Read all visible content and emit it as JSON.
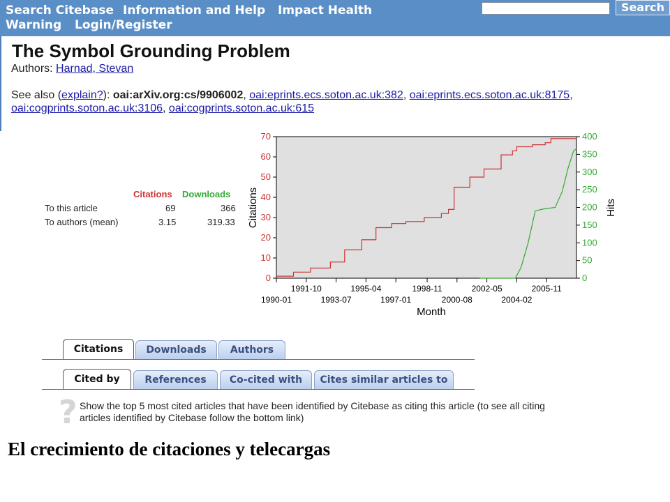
{
  "nav": {
    "links": [
      "Search Citebase",
      "Information and Help",
      "Impact Health",
      "Warning",
      "Login/Register"
    ],
    "search_placeholder": "",
    "search_button": "Search"
  },
  "article": {
    "title": "The Symbol Grounding Problem",
    "authors_label": "Authors: ",
    "author": "Harnad, Stevan",
    "see_also_label": "See also (",
    "explain_link": "explain?",
    "see_also_close": "): ",
    "primary_id": "oai:arXiv.org:cs/9906002",
    "sep": ", ",
    "other_ids": [
      "oai:eprints.ecs.soton.ac.uk:382",
      "oai:eprints.ecs.soton.ac.uk:8175",
      "oai:cogprints.soton.ac.uk:3106",
      "oai:cogprints.soton.ac.uk:615"
    ]
  },
  "stats": {
    "headers": [
      "Citations",
      "Downloads"
    ],
    "rows": [
      {
        "label": "To this article",
        "citations": "69",
        "downloads": "366"
      },
      {
        "label": "To authors (mean)",
        "citations": "3.15",
        "downloads": "319.33"
      }
    ],
    "colors": {
      "citations": "#cc3333",
      "downloads": "#33aa33"
    }
  },
  "chart_data": {
    "type": "line",
    "xlabel": "Month",
    "ylabel": "Citations",
    "y2label": "Hits",
    "x_ticks_upper": [
      "1991-10",
      "1995-04",
      "1998-11",
      "2002-05",
      "2005-11"
    ],
    "x_ticks_lower": [
      "1990-01",
      "1993-07",
      "1997-01",
      "2000-08",
      "2004-02"
    ],
    "x_range": [
      "1990-01",
      "2007-08"
    ],
    "ylim": [
      0,
      70
    ],
    "y_ticks": [
      0,
      10,
      20,
      30,
      40,
      50,
      60,
      70
    ],
    "y2lim": [
      0,
      400
    ],
    "y2_ticks": [
      0,
      50,
      100,
      150,
      200,
      250,
      300,
      350,
      400
    ],
    "background": "#e0e0e0",
    "series": [
      {
        "name": "Citations",
        "axis": "left",
        "color": "#cc3333",
        "step": true,
        "points": [
          [
            "1990-01",
            1
          ],
          [
            "1991-01",
            3
          ],
          [
            "1992-01",
            5
          ],
          [
            "1993-03",
            8
          ],
          [
            "1994-01",
            14
          ],
          [
            "1995-01",
            19
          ],
          [
            "1995-11",
            25
          ],
          [
            "1996-10",
            27
          ],
          [
            "1997-08",
            28
          ],
          [
            "1998-09",
            30
          ],
          [
            "1999-09",
            32
          ],
          [
            "2000-02",
            34
          ],
          [
            "2000-06",
            45
          ],
          [
            "2001-05",
            50
          ],
          [
            "2002-03",
            54
          ],
          [
            "2003-03",
            61
          ],
          [
            "2003-11",
            63
          ],
          [
            "2004-02",
            65
          ],
          [
            "2005-01",
            66
          ],
          [
            "2005-10",
            67
          ],
          [
            "2006-02",
            69
          ],
          [
            "2007-08",
            69
          ]
        ]
      },
      {
        "name": "Downloads",
        "axis": "right",
        "color": "#33aa33",
        "step": false,
        "points": [
          [
            "2001-12",
            0
          ],
          [
            "2004-01",
            0
          ],
          [
            "2004-05",
            30
          ],
          [
            "2004-10",
            100
          ],
          [
            "2005-03",
            190
          ],
          [
            "2005-08",
            195
          ],
          [
            "2006-05",
            200
          ],
          [
            "2006-10",
            245
          ],
          [
            "2007-02",
            310
          ],
          [
            "2007-06",
            360
          ],
          [
            "2007-08",
            366
          ]
        ]
      }
    ]
  },
  "tabs_row1": [
    "Citations",
    "Downloads",
    "Authors"
  ],
  "tabs_row2": [
    "Cited by",
    "References",
    "Co-cited with",
    "Cites similar articles to"
  ],
  "help": {
    "text": "Show the top 5 most cited articles that have been identified by Citebase as citing this article (to see all citing articles identified by Citebase follow the bottom link)"
  },
  "caption": "El crecimiento de citaciones y telecargas"
}
